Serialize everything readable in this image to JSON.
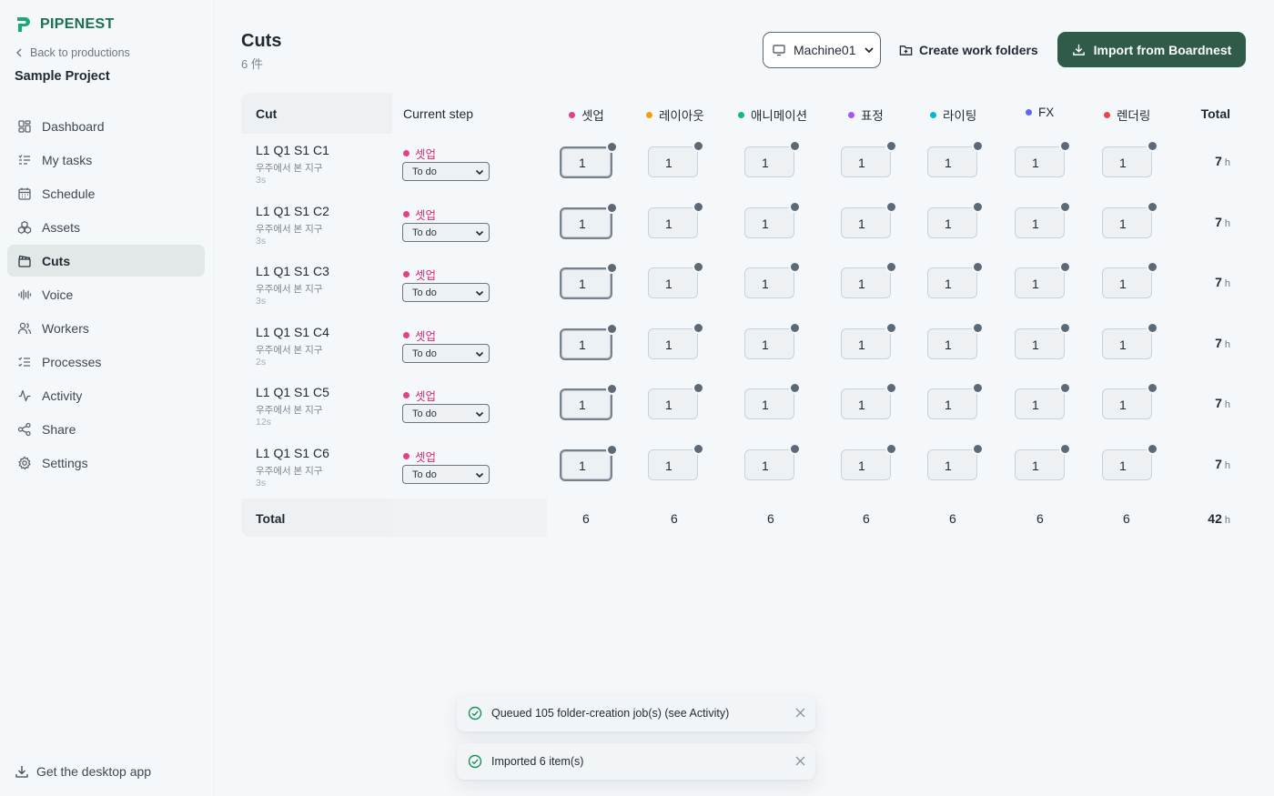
{
  "app": {
    "name": "PIPENEST",
    "brand_color": "#1b6e4f",
    "accent_color": "#2f5b48"
  },
  "sidebar": {
    "back_label": "Back to productions",
    "project_name": "Sample Project",
    "items": [
      {
        "label": "Dashboard",
        "icon": "dashboard-icon"
      },
      {
        "label": "My tasks",
        "icon": "tasks-icon"
      },
      {
        "label": "Schedule",
        "icon": "calendar-icon"
      },
      {
        "label": "Assets",
        "icon": "assets-icon"
      },
      {
        "label": "Cuts",
        "icon": "clapper-icon",
        "active": true
      },
      {
        "label": "Voice",
        "icon": "waveform-icon"
      },
      {
        "label": "Workers",
        "icon": "users-icon"
      },
      {
        "label": "Processes",
        "icon": "checklist-icon"
      },
      {
        "label": "Activity",
        "icon": "activity-icon"
      },
      {
        "label": "Share",
        "icon": "share-icon"
      },
      {
        "label": "Settings",
        "icon": "gear-icon"
      }
    ],
    "desktop_app_label": "Get the desktop app"
  },
  "header": {
    "title": "Cuts",
    "count": "6 件",
    "machine_select": "Machine01",
    "create_folders_label": "Create work folders",
    "import_label": "Import from Boardnest"
  },
  "table": {
    "col_cut": "Cut",
    "col_step": "Current step",
    "col_total": "Total",
    "steps": [
      {
        "name": "셋업",
        "color": "#e63f86"
      },
      {
        "name": "레이아웃",
        "color": "#f59e0b"
      },
      {
        "name": "애니메이션",
        "color": "#10b981"
      },
      {
        "name": "표정",
        "color": "#a855f7"
      },
      {
        "name": "라이팅",
        "color": "#06b6d4"
      },
      {
        "name": "FX",
        "color": "#6366f1"
      },
      {
        "name": "렌더링",
        "color": "#ef4444"
      }
    ],
    "rows": [
      {
        "name": "L1 Q1 S1 C1",
        "sub": "우주에서 본 지구",
        "dur": "3s",
        "step": "셋업",
        "status": "To do",
        "values": [
          "1",
          "1",
          "1",
          "1",
          "1",
          "1",
          "1"
        ],
        "total": "7",
        "unit": "h"
      },
      {
        "name": "L1 Q1 S1 C2",
        "sub": "우주에서 본 지구",
        "dur": "3s",
        "step": "셋업",
        "status": "To do",
        "values": [
          "1",
          "1",
          "1",
          "1",
          "1",
          "1",
          "1"
        ],
        "total": "7",
        "unit": "h"
      },
      {
        "name": "L1 Q1 S1 C3",
        "sub": "우주에서 본 지구",
        "dur": "3s",
        "step": "셋업",
        "status": "To do",
        "values": [
          "1",
          "1",
          "1",
          "1",
          "1",
          "1",
          "1"
        ],
        "total": "7",
        "unit": "h"
      },
      {
        "name": "L1 Q1 S1 C4",
        "sub": "우주에서 본 지구",
        "dur": "2s",
        "step": "셋업",
        "status": "To do",
        "values": [
          "1",
          "1",
          "1",
          "1",
          "1",
          "1",
          "1"
        ],
        "total": "7",
        "unit": "h"
      },
      {
        "name": "L1 Q1 S1 C5",
        "sub": "우주에서 본 지구",
        "dur": "12s",
        "step": "셋업",
        "status": "To do",
        "values": [
          "1",
          "1",
          "1",
          "1",
          "1",
          "1",
          "1"
        ],
        "total": "7",
        "unit": "h"
      },
      {
        "name": "L1 Q1 S1 C6",
        "sub": "우주에서 본 지구",
        "dur": "3s",
        "step": "셋업",
        "status": "To do",
        "values": [
          "1",
          "1",
          "1",
          "1",
          "1",
          "1",
          "1"
        ],
        "total": "7",
        "unit": "h"
      }
    ],
    "footer": {
      "label": "Total",
      "values": [
        "6",
        "6",
        "6",
        "6",
        "6",
        "6",
        "6"
      ],
      "total": "42",
      "unit": "h"
    }
  },
  "toasts": [
    {
      "message": "Queued 105 folder-creation job(s) (see Activity)"
    },
    {
      "message": "Imported 6 item(s)"
    }
  ]
}
